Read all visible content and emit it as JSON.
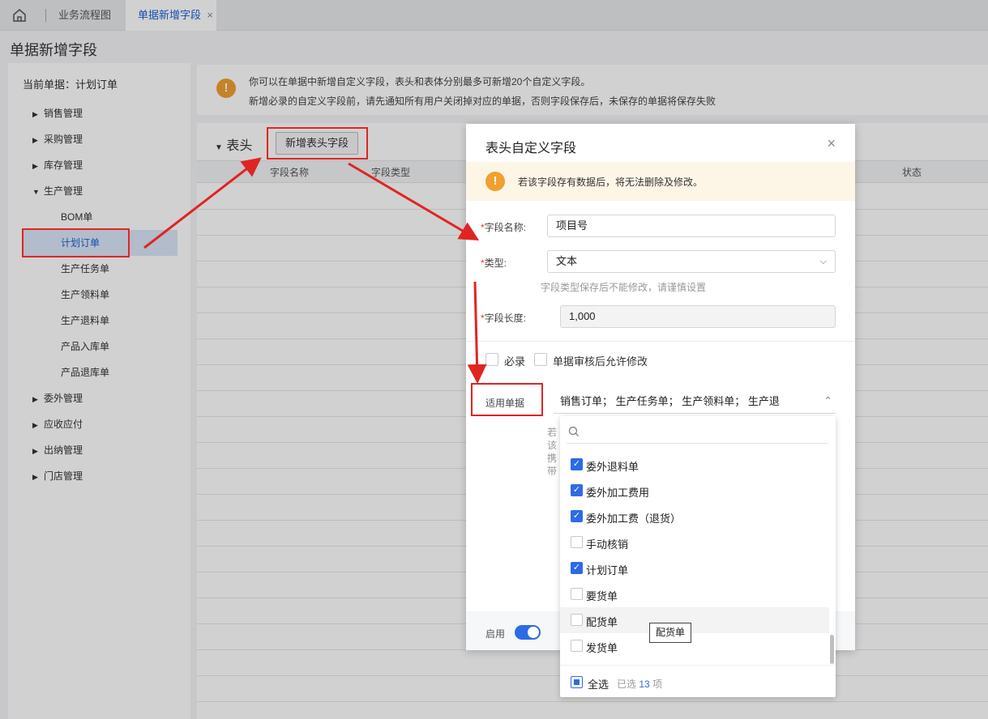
{
  "tabs": {
    "home_icon": "home-icon",
    "tab1": "业务流程图",
    "tab2": "单据新增字段",
    "close": "×"
  },
  "page_title": "单据新增字段",
  "sidebar": {
    "current_doc": "当前单据：计划订单",
    "groups": [
      {
        "label": "销售管理",
        "expanded": false
      },
      {
        "label": "采购管理",
        "expanded": false
      },
      {
        "label": "库存管理",
        "expanded": false
      },
      {
        "label": "生产管理",
        "expanded": true
      },
      {
        "label": "委外管理",
        "expanded": false
      },
      {
        "label": "应收应付",
        "expanded": false
      },
      {
        "label": "出纳管理",
        "expanded": false
      },
      {
        "label": "门店管理",
        "expanded": false
      }
    ],
    "sub_items": [
      "BOM单",
      "计划订单",
      "生产任务单",
      "生产领料单",
      "生产退料单",
      "产品入库单",
      "产品退库单"
    ],
    "active_sub": "计划订单"
  },
  "notice": {
    "line1": "你可以在单据中新增自定义字段，表头和表体分别最多可新增20个自定义字段。",
    "line2": "新增必录的自定义字段前，请先通知所有用户关闭掉对应的单据，否则字段保存后，未保存的单据将保存失败"
  },
  "section": {
    "title": "表头",
    "add_button": "新增表头字段",
    "columns": [
      "字段名称",
      "字段类型",
      "状态"
    ]
  },
  "dialog": {
    "title": "表头自定义字段",
    "close": "×",
    "warning": "若该字段存有数据后，将无法删除及修改。",
    "field_name_label": "字段名称:",
    "field_name_value": "项目号",
    "type_label": "类型:",
    "type_value": "文本",
    "type_hint": "字段类型保存后不能修改，请谨慎设置",
    "length_label": "字段长度:",
    "length_value": "1,000",
    "required_label": "必录",
    "allow_edit_label": "单据审核后允许修改",
    "applicable_label": "适用单据",
    "applicable_value": "销售订单； 生产任务单； 生产领料单； 生产退",
    "partial_hint": "若该携带",
    "enable_label": "启用",
    "enabled": true
  },
  "dropdown": {
    "search_icon": "search-icon",
    "items": [
      {
        "label": "委外退料单",
        "checked": true
      },
      {
        "label": "委外加工费用",
        "checked": true
      },
      {
        "label": "委外加工费（退货）",
        "checked": true
      },
      {
        "label": "手动核销",
        "checked": false
      },
      {
        "label": "计划订单",
        "checked": true
      },
      {
        "label": "要货单",
        "checked": false
      },
      {
        "label": "配货单",
        "checked": false
      },
      {
        "label": "发货单",
        "checked": false
      }
    ],
    "select_all": "全选",
    "selected_prefix": "已选",
    "selected_count": "13",
    "selected_suffix": "项",
    "tooltip": "配货单"
  },
  "colors": {
    "accent": "#2d6be4",
    "annotation": "#e02424",
    "warning": "#f0a030"
  }
}
